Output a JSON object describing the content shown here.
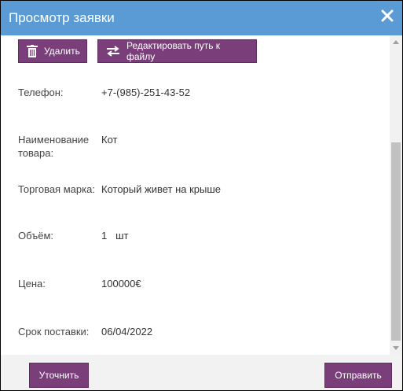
{
  "dialog": {
    "title": "Просмотр заявки",
    "close_icon": "close-icon"
  },
  "toolbar": {
    "delete_label": "Удалить",
    "delete_icon": "trash-icon",
    "edit_path_label": "Редактировать путь к файлу",
    "edit_path_icon": "swap-arrows-icon"
  },
  "fields": [
    {
      "label": "Телефон:",
      "value": "+7-(985)-251-43-52"
    },
    {
      "label": "Наименование товара:",
      "value": "Кот"
    },
    {
      "label": "Торговая марка:",
      "value": "Который живет на крыше"
    },
    {
      "label": "Объём:",
      "value": "1   шт"
    },
    {
      "label": "Цена:",
      "value": "100000€"
    },
    {
      "label": "Срок поставки:",
      "value": "06/04/2022"
    }
  ],
  "footer": {
    "clarify_label": "Уточнить",
    "send_label": "Отправить"
  },
  "colors": {
    "titlebar": "#5b9bd5",
    "button": "#7a3e7a",
    "footer": "#f2f2f2"
  }
}
